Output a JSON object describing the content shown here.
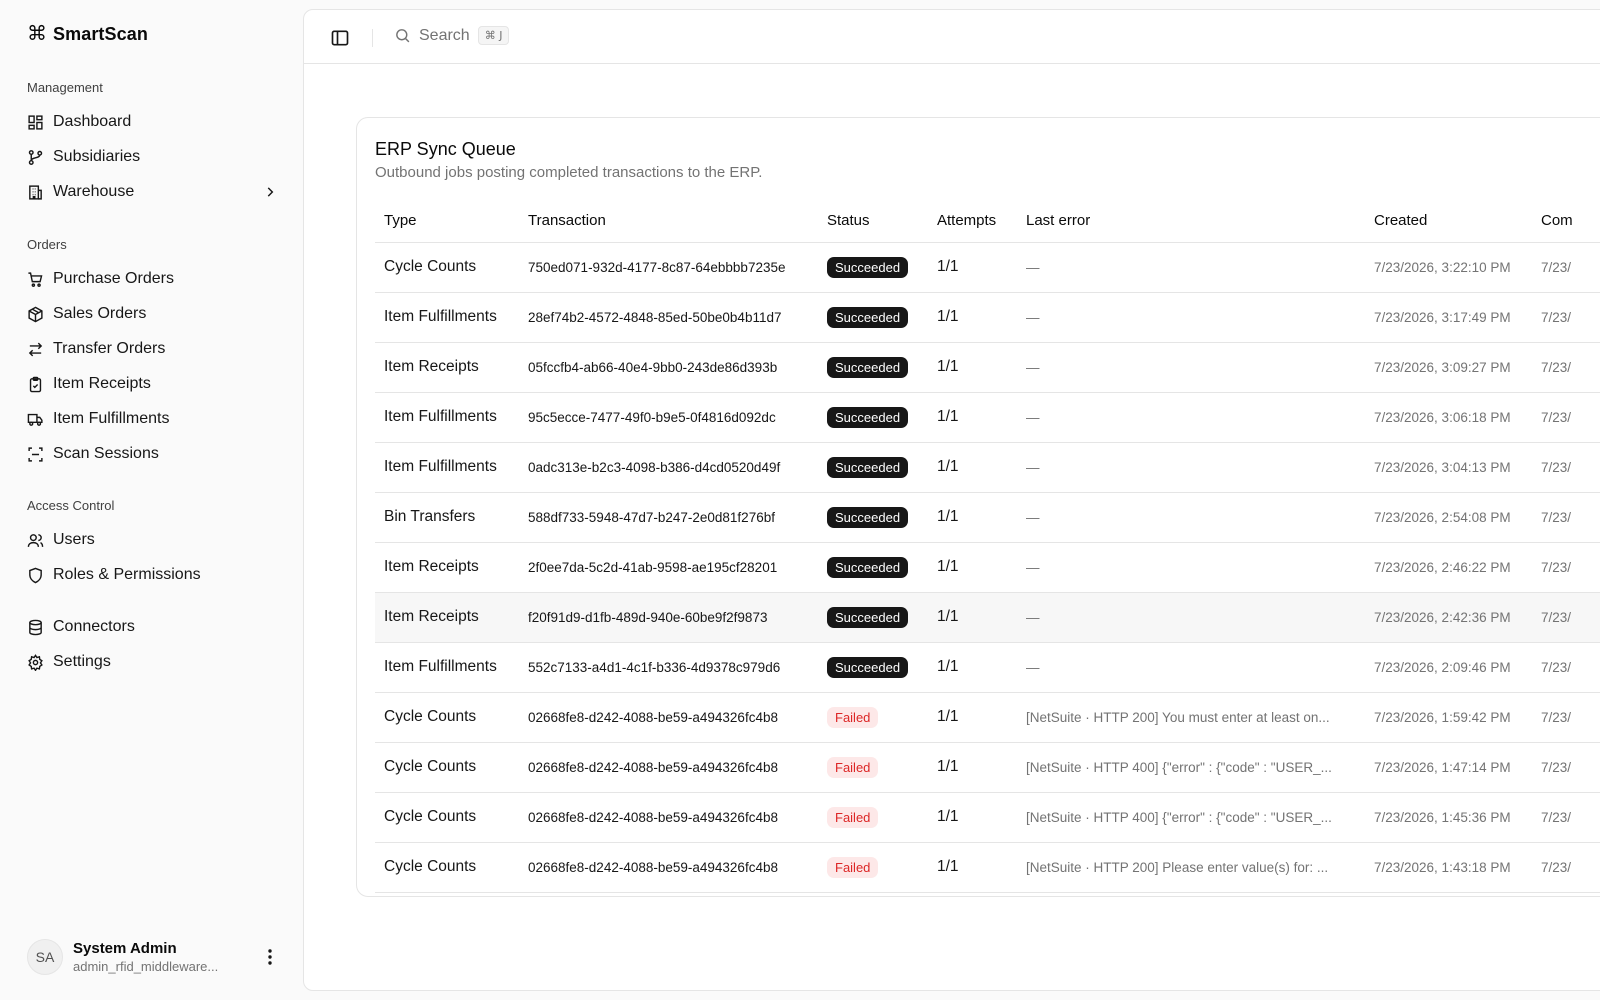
{
  "app": {
    "name": "SmartScan"
  },
  "sidebar": {
    "groups": [
      {
        "label": "Management",
        "items": [
          {
            "label": "Dashboard"
          },
          {
            "label": "Subsidiaries"
          },
          {
            "label": "Warehouse"
          }
        ]
      },
      {
        "label": "Orders",
        "items": [
          {
            "label": "Purchase Orders"
          },
          {
            "label": "Sales Orders"
          },
          {
            "label": "Transfer Orders"
          },
          {
            "label": "Item Receipts"
          },
          {
            "label": "Item Fulfillments"
          },
          {
            "label": "Scan Sessions"
          }
        ]
      },
      {
        "label": "Access Control",
        "items": [
          {
            "label": "Users"
          },
          {
            "label": "Roles & Permissions"
          }
        ]
      },
      {
        "label": "",
        "items": [
          {
            "label": "Connectors"
          },
          {
            "label": "Settings"
          }
        ]
      }
    ],
    "user": {
      "initials": "SA",
      "name": "System Admin",
      "email": "admin_rfid_middleware..."
    }
  },
  "topbar": {
    "search_placeholder": "Search",
    "shortcut": "⌘ J"
  },
  "queue": {
    "title": "ERP Sync Queue",
    "subtitle": "Outbound jobs posting completed transactions to the ERP.",
    "columns": [
      "Type",
      "Transaction",
      "Status",
      "Attempts",
      "Last error",
      "Created",
      "Com"
    ],
    "rows": [
      {
        "type": "Cycle Counts",
        "tx": "750ed071-932d-4177-8c87-64ebbbb7235e",
        "status": "Succeeded",
        "attempts": "1/1",
        "error": "—",
        "created": "7/23/2026, 3:22:10 PM",
        "completed": "7/23/"
      },
      {
        "type": "Item Fulfillments",
        "tx": "28ef74b2-4572-4848-85ed-50be0b4b11d7",
        "status": "Succeeded",
        "attempts": "1/1",
        "error": "—",
        "created": "7/23/2026, 3:17:49 PM",
        "completed": "7/23/"
      },
      {
        "type": "Item Receipts",
        "tx": "05fccfb4-ab66-40e4-9bb0-243de86d393b",
        "status": "Succeeded",
        "attempts": "1/1",
        "error": "—",
        "created": "7/23/2026, 3:09:27 PM",
        "completed": "7/23/"
      },
      {
        "type": "Item Fulfillments",
        "tx": "95c5ecce-7477-49f0-b9e5-0f4816d092dc",
        "status": "Succeeded",
        "attempts": "1/1",
        "error": "—",
        "created": "7/23/2026, 3:06:18 PM",
        "completed": "7/23/"
      },
      {
        "type": "Item Fulfillments",
        "tx": "0adc313e-b2c3-4098-b386-d4cd0520d49f",
        "status": "Succeeded",
        "attempts": "1/1",
        "error": "—",
        "created": "7/23/2026, 3:04:13 PM",
        "completed": "7/23/"
      },
      {
        "type": "Bin Transfers",
        "tx": "588df733-5948-47d7-b247-2e0d81f276bf",
        "status": "Succeeded",
        "attempts": "1/1",
        "error": "—",
        "created": "7/23/2026, 2:54:08 PM",
        "completed": "7/23/"
      },
      {
        "type": "Item Receipts",
        "tx": "2f0ee7da-5c2d-41ab-9598-ae195cf28201",
        "status": "Succeeded",
        "attempts": "1/1",
        "error": "—",
        "created": "7/23/2026, 2:46:22 PM",
        "completed": "7/23/"
      },
      {
        "type": "Item Receipts",
        "tx": "f20f91d9-d1fb-489d-940e-60be9f2f9873",
        "status": "Succeeded",
        "attempts": "1/1",
        "error": "—",
        "created": "7/23/2026, 2:42:36 PM",
        "completed": "7/23/"
      },
      {
        "type": "Item Fulfillments",
        "tx": "552c7133-a4d1-4c1f-b336-4d9378c979d6",
        "status": "Succeeded",
        "attempts": "1/1",
        "error": "—",
        "created": "7/23/2026, 2:09:46 PM",
        "completed": "7/23/"
      },
      {
        "type": "Cycle Counts",
        "tx": "02668fe8-d242-4088-be59-a494326fc4b8",
        "status": "Failed",
        "attempts": "1/1",
        "error": "[NetSuite · HTTP 200] You must enter at least on...",
        "created": "7/23/2026, 1:59:42 PM",
        "completed": "7/23/"
      },
      {
        "type": "Cycle Counts",
        "tx": "02668fe8-d242-4088-be59-a494326fc4b8",
        "status": "Failed",
        "attempts": "1/1",
        "error": "[NetSuite · HTTP 400] {\"error\" : {\"code\" : \"USER_...",
        "created": "7/23/2026, 1:47:14 PM",
        "completed": "7/23/"
      },
      {
        "type": "Cycle Counts",
        "tx": "02668fe8-d242-4088-be59-a494326fc4b8",
        "status": "Failed",
        "attempts": "1/1",
        "error": "[NetSuite · HTTP 400] {\"error\" : {\"code\" : \"USER_...",
        "created": "7/23/2026, 1:45:36 PM",
        "completed": "7/23/"
      },
      {
        "type": "Cycle Counts",
        "tx": "02668fe8-d242-4088-be59-a494326fc4b8",
        "status": "Failed",
        "attempts": "1/1",
        "error": "[NetSuite · HTTP 200] Please enter value(s) for: ...",
        "created": "7/23/2026, 1:43:18 PM",
        "completed": "7/23/"
      }
    ]
  }
}
